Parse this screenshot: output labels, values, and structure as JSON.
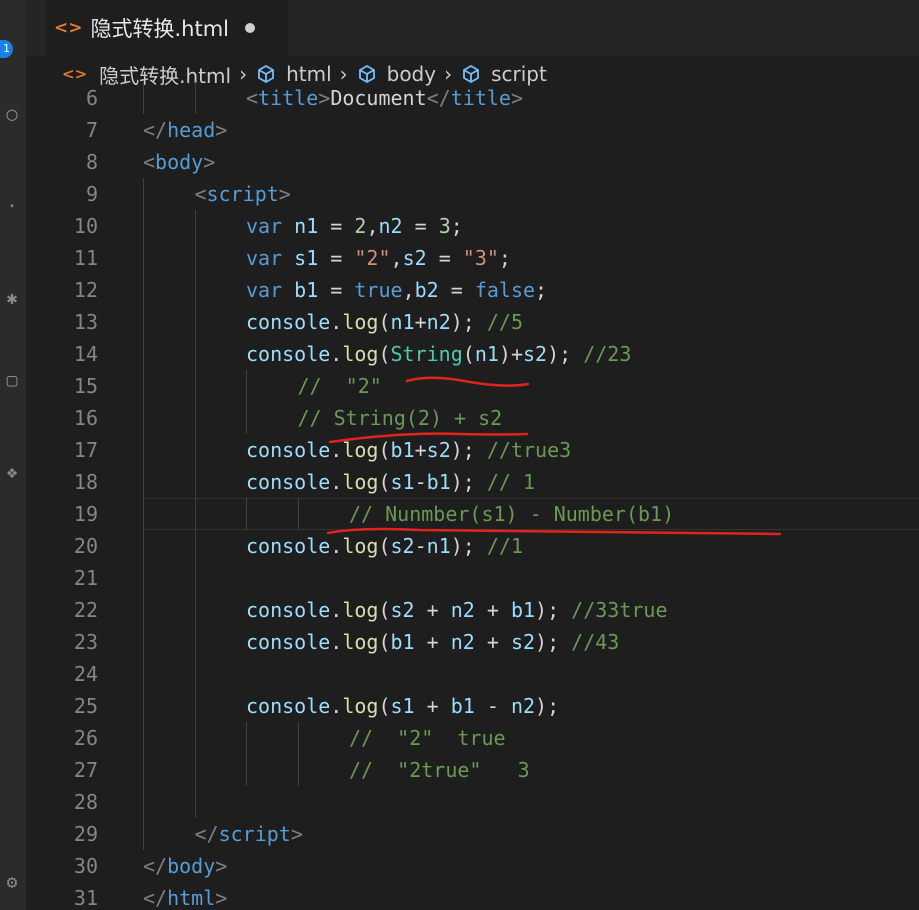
{
  "tab": {
    "filename": "隐式转换.html",
    "icon": "html-file-icon"
  },
  "breadcrumb": [
    {
      "label": "隐式转换.html",
      "icon": "html-file-icon"
    },
    {
      "label": "html",
      "icon": "cube-icon"
    },
    {
      "label": "body",
      "icon": "cube-icon"
    },
    {
      "label": "script",
      "icon": "cube-icon"
    }
  ],
  "activity_bar": {
    "badge": "1"
  },
  "colors": {
    "annotation": "#e0241b",
    "accent": "#1b81e8",
    "html_icon": "#e37933"
  },
  "code_lines": [
    {
      "number": "6",
      "indent": 2,
      "tokens": [
        [
          "t-br",
          "<"
        ],
        [
          "t-tag",
          "title"
        ],
        [
          "t-br",
          ">"
        ],
        [
          "t-txt",
          "Document"
        ],
        [
          "t-br",
          "</"
        ],
        [
          "t-tag",
          "title"
        ],
        [
          "t-br",
          ">"
        ]
      ]
    },
    {
      "number": "7",
      "indent": 0,
      "tokens": [
        [
          "t-br",
          "</"
        ],
        [
          "t-tag",
          "head"
        ],
        [
          "t-br",
          ">"
        ]
      ]
    },
    {
      "number": "8",
      "indent": 0,
      "tokens": [
        [
          "t-br",
          "<"
        ],
        [
          "t-tag",
          "body"
        ],
        [
          "t-br",
          ">"
        ]
      ]
    },
    {
      "number": "9",
      "indent": 1,
      "tokens": [
        [
          "t-br",
          "<"
        ],
        [
          "t-tag",
          "script"
        ],
        [
          "t-br",
          ">"
        ]
      ]
    },
    {
      "number": "10",
      "indent": 2,
      "tokens": [
        [
          "t-kw",
          "var"
        ],
        [
          "t-op",
          " "
        ],
        [
          "t-var",
          "n1"
        ],
        [
          "t-op",
          " = "
        ],
        [
          "t-num",
          "2"
        ],
        [
          "t-op",
          ","
        ],
        [
          "t-var",
          "n2"
        ],
        [
          "t-op",
          " = "
        ],
        [
          "t-num",
          "3"
        ],
        [
          "t-op",
          ";"
        ]
      ]
    },
    {
      "number": "11",
      "indent": 2,
      "tokens": [
        [
          "t-kw",
          "var"
        ],
        [
          "t-op",
          " "
        ],
        [
          "t-var",
          "s1"
        ],
        [
          "t-op",
          " = "
        ],
        [
          "t-str",
          "\"2\""
        ],
        [
          "t-op",
          ","
        ],
        [
          "t-var",
          "s2"
        ],
        [
          "t-op",
          " = "
        ],
        [
          "t-str",
          "\"3\""
        ],
        [
          "t-op",
          ";"
        ]
      ]
    },
    {
      "number": "12",
      "indent": 2,
      "tokens": [
        [
          "t-kw",
          "var"
        ],
        [
          "t-op",
          " "
        ],
        [
          "t-var",
          "b1"
        ],
        [
          "t-op",
          " = "
        ],
        [
          "t-kw",
          "true"
        ],
        [
          "t-op",
          ","
        ],
        [
          "t-var",
          "b2"
        ],
        [
          "t-op",
          " = "
        ],
        [
          "t-kw",
          "false"
        ],
        [
          "t-op",
          ";"
        ]
      ]
    },
    {
      "number": "13",
      "indent": 2,
      "tokens": [
        [
          "t-var",
          "console"
        ],
        [
          "t-op",
          "."
        ],
        [
          "t-fn",
          "log"
        ],
        [
          "t-op",
          "("
        ],
        [
          "t-var",
          "n1"
        ],
        [
          "t-op",
          "+"
        ],
        [
          "t-var",
          "n2"
        ],
        [
          "t-op",
          "); "
        ],
        [
          "t-com",
          "//5"
        ]
      ]
    },
    {
      "number": "14",
      "indent": 2,
      "tokens": [
        [
          "t-var",
          "console"
        ],
        [
          "t-op",
          "."
        ],
        [
          "t-fn",
          "log"
        ],
        [
          "t-op",
          "("
        ],
        [
          "t-cls",
          "String"
        ],
        [
          "t-op",
          "("
        ],
        [
          "t-var",
          "n1"
        ],
        [
          "t-op",
          ")+"
        ],
        [
          "t-var",
          "s2"
        ],
        [
          "t-op",
          "); "
        ],
        [
          "t-com",
          "//23"
        ]
      ]
    },
    {
      "number": "15",
      "indent": 3,
      "tokens": [
        [
          "t-com",
          "//  \"2\""
        ]
      ]
    },
    {
      "number": "16",
      "indent": 3,
      "tokens": [
        [
          "t-com",
          "// String(2) + s2"
        ]
      ]
    },
    {
      "number": "17",
      "indent": 2,
      "tokens": [
        [
          "t-var",
          "console"
        ],
        [
          "t-op",
          "."
        ],
        [
          "t-fn",
          "log"
        ],
        [
          "t-op",
          "("
        ],
        [
          "t-var",
          "b1"
        ],
        [
          "t-op",
          "+"
        ],
        [
          "t-var",
          "s2"
        ],
        [
          "t-op",
          "); "
        ],
        [
          "t-com",
          "//true3"
        ]
      ]
    },
    {
      "number": "18",
      "indent": 2,
      "tokens": [
        [
          "t-var",
          "console"
        ],
        [
          "t-op",
          "."
        ],
        [
          "t-fn",
          "log"
        ],
        [
          "t-op",
          "("
        ],
        [
          "t-var",
          "s1"
        ],
        [
          "t-op",
          "-"
        ],
        [
          "t-var",
          "b1"
        ],
        [
          "t-op",
          "); "
        ],
        [
          "t-com",
          "// 1"
        ]
      ]
    },
    {
      "number": "19",
      "indent": 4,
      "tokens": [
        [
          "t-com",
          "// Nunmber(s1) - Number(b1)"
        ]
      ]
    },
    {
      "number": "20",
      "indent": 2,
      "tokens": [
        [
          "t-var",
          "console"
        ],
        [
          "t-op",
          "."
        ],
        [
          "t-fn",
          "log"
        ],
        [
          "t-op",
          "("
        ],
        [
          "t-var",
          "s2"
        ],
        [
          "t-op",
          "-"
        ],
        [
          "t-var",
          "n1"
        ],
        [
          "t-op",
          "); "
        ],
        [
          "t-com",
          "//1"
        ]
      ]
    },
    {
      "number": "21",
      "indent": 2,
      "tokens": []
    },
    {
      "number": "22",
      "indent": 2,
      "tokens": [
        [
          "t-var",
          "console"
        ],
        [
          "t-op",
          "."
        ],
        [
          "t-fn",
          "log"
        ],
        [
          "t-op",
          "("
        ],
        [
          "t-var",
          "s2"
        ],
        [
          "t-op",
          " + "
        ],
        [
          "t-var",
          "n2"
        ],
        [
          "t-op",
          " + "
        ],
        [
          "t-var",
          "b1"
        ],
        [
          "t-op",
          "); "
        ],
        [
          "t-com",
          "//33true"
        ]
      ]
    },
    {
      "number": "23",
      "indent": 2,
      "tokens": [
        [
          "t-var",
          "console"
        ],
        [
          "t-op",
          "."
        ],
        [
          "t-fn",
          "log"
        ],
        [
          "t-op",
          "("
        ],
        [
          "t-var",
          "b1"
        ],
        [
          "t-op",
          " + "
        ],
        [
          "t-var",
          "n2"
        ],
        [
          "t-op",
          " + "
        ],
        [
          "t-var",
          "s2"
        ],
        [
          "t-op",
          "); "
        ],
        [
          "t-com",
          "//43"
        ]
      ]
    },
    {
      "number": "24",
      "indent": 2,
      "tokens": []
    },
    {
      "number": "25",
      "indent": 2,
      "tokens": [
        [
          "t-var",
          "console"
        ],
        [
          "t-op",
          "."
        ],
        [
          "t-fn",
          "log"
        ],
        [
          "t-op",
          "("
        ],
        [
          "t-var",
          "s1"
        ],
        [
          "t-op",
          " + "
        ],
        [
          "t-var",
          "b1"
        ],
        [
          "t-op",
          " - "
        ],
        [
          "t-var",
          "n2"
        ],
        [
          "t-op",
          ");"
        ]
      ]
    },
    {
      "number": "26",
      "indent": 4,
      "tokens": [
        [
          "t-com",
          "//  \"2\"  true"
        ]
      ]
    },
    {
      "number": "27",
      "indent": 4,
      "tokens": [
        [
          "t-com",
          "//  \"2true\"   3"
        ]
      ]
    },
    {
      "number": "28",
      "indent": 2,
      "tokens": []
    },
    {
      "number": "29",
      "indent": 1,
      "tokens": [
        [
          "t-br",
          "</"
        ],
        [
          "t-tag",
          "script"
        ],
        [
          "t-br",
          ">"
        ]
      ]
    },
    {
      "number": "30",
      "indent": 0,
      "tokens": [
        [
          "t-br",
          "</"
        ],
        [
          "t-tag",
          "body"
        ],
        [
          "t-br",
          ">"
        ]
      ]
    },
    {
      "number": "31",
      "indent": 0,
      "tokens": [
        [
          "t-br",
          "</"
        ],
        [
          "t-tag",
          "html"
        ],
        [
          "t-br",
          ">"
        ]
      ]
    }
  ]
}
